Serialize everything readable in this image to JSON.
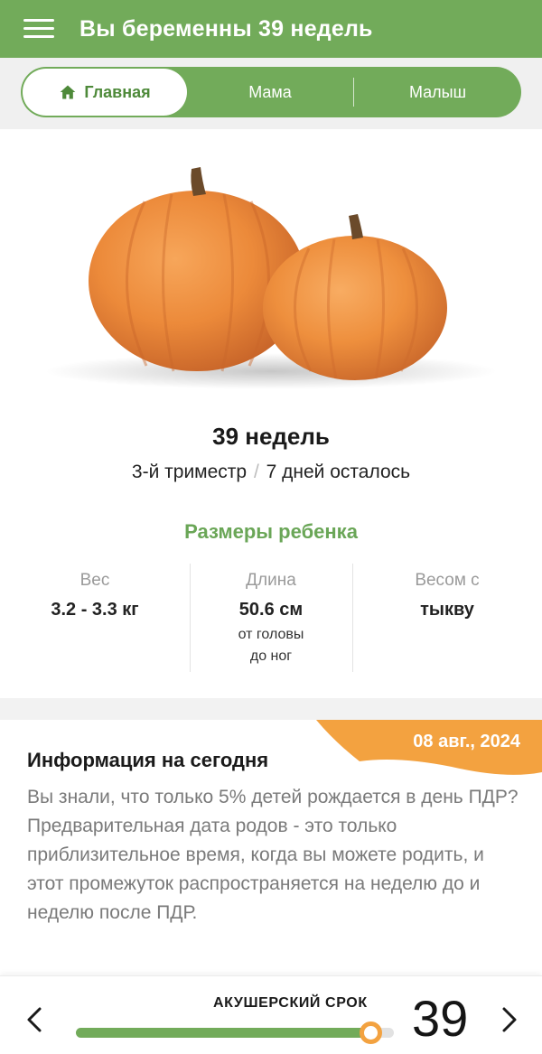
{
  "header": {
    "title": "Вы беременны 39 недель",
    "menu_icon": "hamburger-menu-icon"
  },
  "tabs": [
    {
      "label": "Главная",
      "icon": "home-icon",
      "active": true
    },
    {
      "label": "Мама",
      "active": false
    },
    {
      "label": "Малыш",
      "active": false
    }
  ],
  "hero": {
    "image": "pumpkins"
  },
  "week": {
    "title": "39 недель",
    "trimester": "3-й триместр",
    "separator": "/",
    "remaining": "7 дней осталось"
  },
  "sizes": {
    "title": "Размеры ребенка",
    "weight": {
      "label": "Вес",
      "value": "3.2 - 3.3 кг"
    },
    "length": {
      "label": "Длина",
      "value": "50.6 см",
      "note_line1": "от головы",
      "note_line2": "до ног"
    },
    "compare": {
      "label": "Весом с",
      "value": "тыкву"
    }
  },
  "info": {
    "date": "08 авг., 2024",
    "title": "Информация на сегодня",
    "body": "Вы знали, что только 5% детей рождается в день ПДР? Предварительная дата родов - это только приблизительное время, когда вы можете родить, и этот промежуток распространяется на неделю до и неделю после ПДР."
  },
  "bottom": {
    "term_label": "АКУШЕРСКИЙ СРОК",
    "week_number": "39",
    "progress_fraction": 0.925,
    "prev_icon": "chevron-left-icon",
    "next_icon": "chevron-right-icon"
  },
  "colors": {
    "primary": "#72ab5a",
    "accent": "#f3a240",
    "pumpkin": "#ec8a3a"
  }
}
